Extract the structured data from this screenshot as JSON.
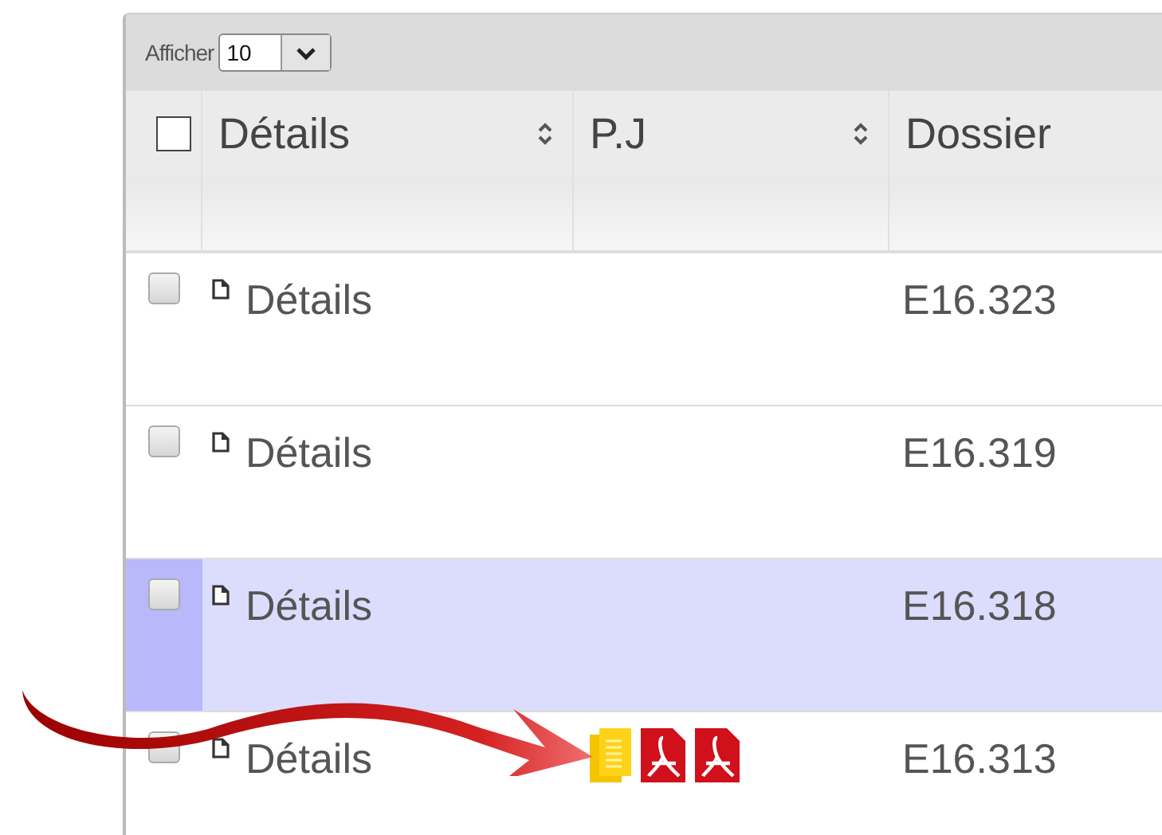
{
  "toolbar": {
    "label": "Afficher",
    "page_size": "10"
  },
  "select_all": {
    "checked": false
  },
  "columns": [
    {
      "label": "Détails",
      "sortable": true
    },
    {
      "label": "P.J",
      "sortable": true
    },
    {
      "label": "Dossier",
      "sortable": false
    }
  ],
  "rows": [
    {
      "selected": false,
      "details": "Détails",
      "attachments": [],
      "dossier": "E16.323"
    },
    {
      "selected": false,
      "details": "Détails",
      "attachments": [],
      "dossier": "E16.319"
    },
    {
      "selected": true,
      "details": "Détails",
      "attachments": [],
      "dossier": "E16.318"
    },
    {
      "selected": false,
      "details": "Détails",
      "attachments": [
        {
          "kind": "archive"
        },
        {
          "kind": "pdf"
        },
        {
          "kind": "pdf"
        }
      ],
      "dossier": "E16.313"
    }
  ],
  "annotation": {
    "kind": "arrow"
  }
}
